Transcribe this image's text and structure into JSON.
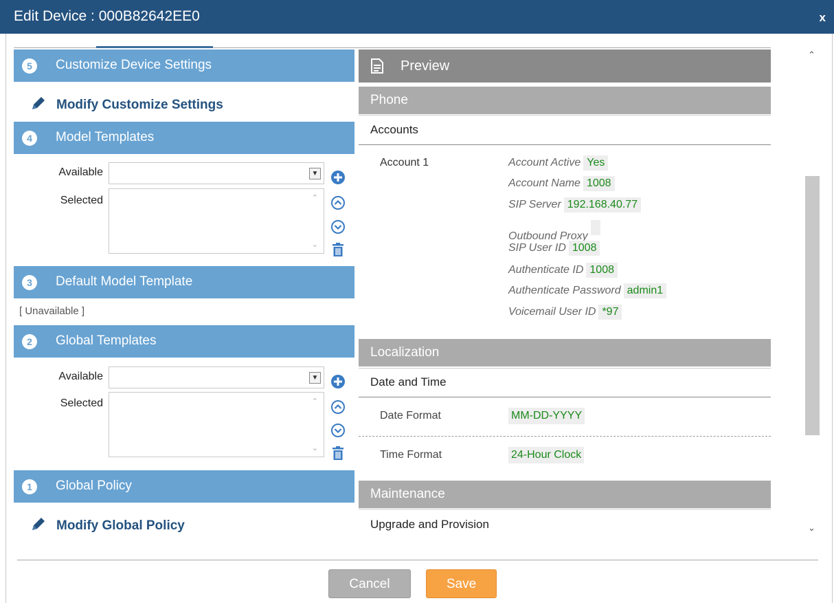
{
  "dialog": {
    "title": "Edit Device : 000B82642EE0",
    "close_label": "x"
  },
  "left": {
    "sections": [
      {
        "number": "5",
        "label": "Customize Device Settings"
      },
      {
        "number": "4",
        "label": "Model Templates"
      },
      {
        "number": "3",
        "label": "Default Model Template"
      },
      {
        "number": "2",
        "label": "Global Templates"
      },
      {
        "number": "1",
        "label": "Global Policy"
      }
    ],
    "modify_customize_label": "Modify Customize Settings",
    "modify_policy_label": "Modify Global Policy",
    "available_label": "Available",
    "selected_label": "Selected",
    "unavailable_text": "[ Unavailable ]"
  },
  "preview": {
    "title": "Preview",
    "phone": {
      "header": "Phone",
      "accounts_title": "Accounts",
      "account_label": "Account 1",
      "fields": [
        {
          "key": "Account Active",
          "value": "Yes"
        },
        {
          "key": "Account Name",
          "value": "1008"
        },
        {
          "key": "SIP Server",
          "value": "192.168.40.77"
        },
        {
          "key": "Outbound Proxy",
          "value": ""
        },
        {
          "key": "SIP User ID",
          "value": "1008"
        },
        {
          "key": "Authenticate ID",
          "value": "1008"
        },
        {
          "key": "Authenticate Password",
          "value": "admin1"
        },
        {
          "key": "Voicemail User ID",
          "value": "*97"
        }
      ]
    },
    "localization": {
      "header": "Localization",
      "section_title": "Date and Time",
      "date_format_label": "Date Format",
      "date_format_value": "MM-DD-YYYY",
      "time_format_label": "Time Format",
      "time_format_value": "24-Hour Clock"
    },
    "maintenance": {
      "header": "Maintenance",
      "section_title": "Upgrade and Provision"
    }
  },
  "buttons": {
    "cancel": "Cancel",
    "save": "Save"
  },
  "colors": {
    "title_bar": "#24527f",
    "section_blue": "#68a3d2",
    "value_green": "#1a8a1a",
    "save_orange": "#f7a243"
  }
}
